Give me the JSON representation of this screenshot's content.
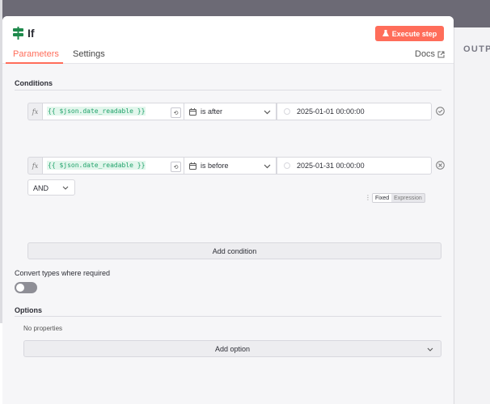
{
  "node": {
    "title": "If",
    "icon": "signpost-icon"
  },
  "header": {
    "execute_label": "Execute step",
    "tabs": [
      "Parameters",
      "Settings"
    ],
    "docs_label": "Docs"
  },
  "output_pane": {
    "label": "OUTP"
  },
  "conditions": {
    "label": "Conditions",
    "rows": [
      {
        "left": "{{ $json.date_readable }}",
        "operator": "is after",
        "value": "2025-01-01 00:00:00",
        "action_icon": "check-circle-icon"
      },
      {
        "left": "{{ $json.date_readable }}",
        "operator": "is before",
        "value": "2025-01-31 00:00:00",
        "action_icon": "remove-circle-icon"
      }
    ],
    "combinator": "AND",
    "mode_toggle": {
      "fixed": "Fixed",
      "expression": "Expression",
      "active": "Fixed"
    },
    "add_label": "Add condition"
  },
  "convert_types": {
    "label": "Convert types where required",
    "enabled": false
  },
  "options": {
    "label": "Options",
    "empty_text": "No properties",
    "add_label": "Add option"
  },
  "colors": {
    "accent": "#ff6d5a",
    "expression_text": "#21a36b",
    "node_icon": "#1f8a4c"
  }
}
